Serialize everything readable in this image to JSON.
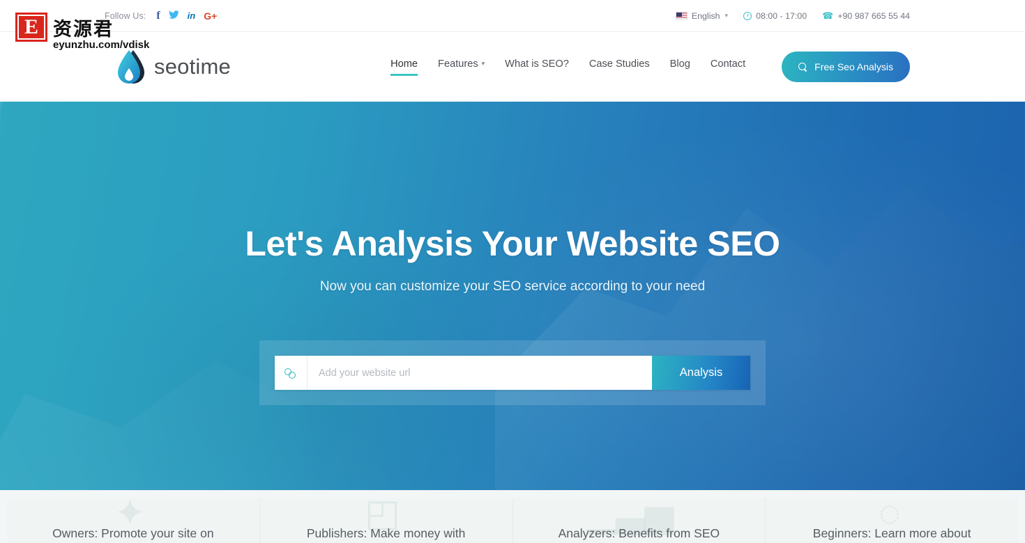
{
  "topbar": {
    "follow_label": "Follow Us:",
    "socials": [
      {
        "name": "facebook",
        "glyph": "f"
      },
      {
        "name": "twitter",
        "glyph": "ᵛ"
      },
      {
        "name": "linkedin",
        "glyph": "in"
      },
      {
        "name": "googleplus",
        "glyph": "G+"
      }
    ],
    "language": "English",
    "hours": "08:00 - 17:00",
    "phone": "+90 987 665 55 44"
  },
  "header": {
    "brand": "seotime",
    "nav": [
      {
        "label": "Home",
        "active": true,
        "caret": false
      },
      {
        "label": "Features",
        "active": false,
        "caret": true
      },
      {
        "label": "What is SEO?",
        "active": false,
        "caret": false
      },
      {
        "label": "Case Studies",
        "active": false,
        "caret": false
      },
      {
        "label": "Blog",
        "active": false,
        "caret": false
      },
      {
        "label": "Contact",
        "active": false,
        "caret": false
      }
    ],
    "cta_label": "Free Seo Analysis"
  },
  "hero": {
    "title": "Let's Analysis Your Website SEO",
    "subtitle": "Now you can customize your SEO service according to your need",
    "input_placeholder": "Add your website url",
    "input_value": "",
    "submit_label": "Analysis"
  },
  "cards": [
    {
      "title": "Owners: Promote your site on",
      "icon": "✦"
    },
    {
      "title": "Publishers: Make money with",
      "icon": "◰"
    },
    {
      "title": "Analyzers: Benefits from SEO",
      "icon": "▁▃▅"
    },
    {
      "title": "Beginners: Learn more about",
      "icon": "◌"
    }
  ],
  "watermark": {
    "letter": "E",
    "cn": "资源君",
    "url": "eyunzhu.com/vdisk"
  },
  "colors": {
    "accent_teal": "#3cc5c0",
    "hero_left": "#2ea7c0",
    "hero_right": "#1c63ad",
    "text_dark": "#4b4f55"
  }
}
